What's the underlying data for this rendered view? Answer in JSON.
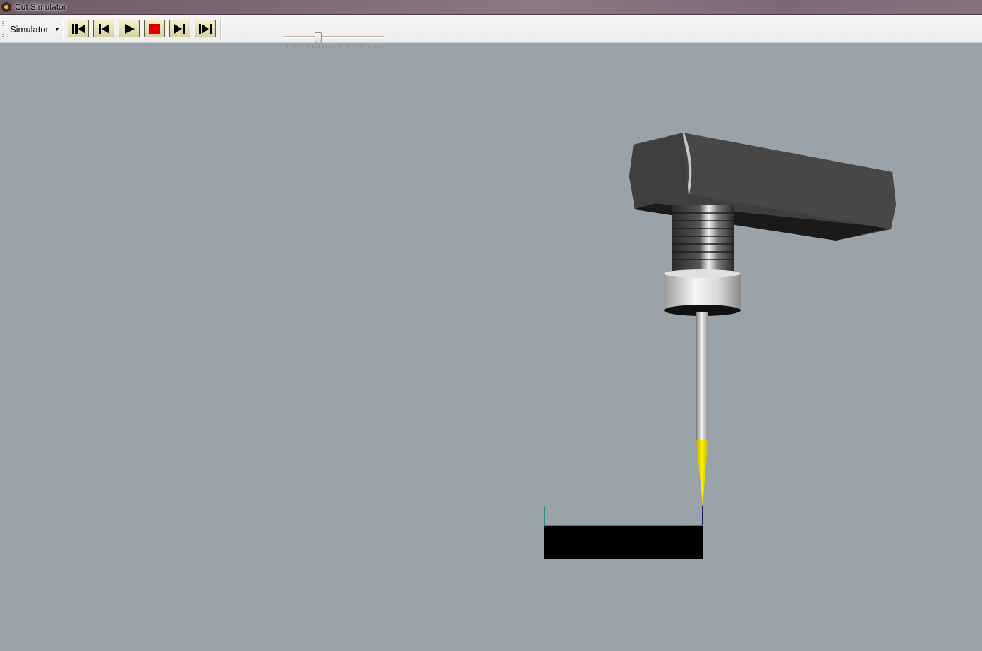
{
  "window": {
    "title": "Cut Simulator",
    "icon": "app-icon"
  },
  "toolbar": {
    "menu_label": "Simulator",
    "buttons": [
      {
        "name": "rewind-button",
        "icon": "rewind-to-start-icon"
      },
      {
        "name": "step-back-button",
        "icon": "step-back-icon"
      },
      {
        "name": "play-button",
        "icon": "play-icon"
      },
      {
        "name": "stop-button",
        "icon": "stop-icon"
      },
      {
        "name": "step-forward-button",
        "icon": "step-forward-icon"
      },
      {
        "name": "fast-forward-button",
        "icon": "fast-forward-to-end-icon"
      }
    ],
    "speed_slider": {
      "value": 0.33
    }
  },
  "colors": {
    "viewport_background": "#9aa2aa",
    "stop_icon": "#e00000",
    "tool_tip": "#f2e000",
    "workpiece": "#000000",
    "spindle_housing": "#3d3d3d"
  }
}
